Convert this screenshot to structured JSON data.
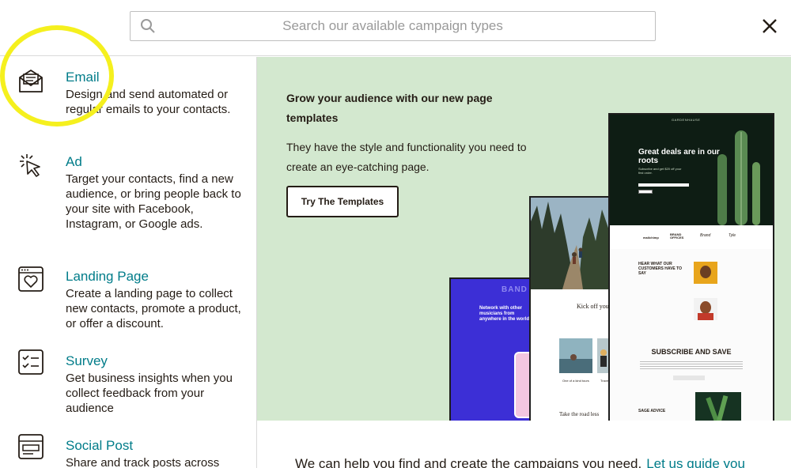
{
  "search": {
    "placeholder": "Search our available campaign types"
  },
  "sidebar": {
    "items": [
      {
        "title": "Email",
        "description": "Design and send automated or regular emails to your contacts.",
        "icon": "email-icon"
      },
      {
        "title": "Ad",
        "description": "Target your contacts, find a new audience, or bring people back to your site with Facebook, Instagram, or Google ads.",
        "icon": "cursor-click-icon"
      },
      {
        "title": "Landing Page",
        "description": "Create a landing page to collect new contacts, promote a product, or offer a discount.",
        "icon": "heart-page-icon"
      },
      {
        "title": "Survey",
        "description": "Get business insights when you collect feedback from your audience",
        "icon": "checklist-icon"
      },
      {
        "title": "Social Post",
        "description": "Share and track posts across",
        "icon": "social-post-icon"
      }
    ]
  },
  "promo": {
    "title": "Grow your audience with our new page templates",
    "description": "They have the style and functionality you need to create an eye-catching page.",
    "button": "Try The Templates",
    "mock_band": {
      "logo": "BAND",
      "headline": "Network with other musicians from anywhere in the world"
    },
    "mock_hike": {
      "heading": "Kick off your",
      "caption1": "One of a kind tours",
      "caption2": "Trave",
      "footer": "Take the road less"
    },
    "mock_garden": {
      "brand": "GARDENHAUSE",
      "headline": "Great deals are in our roots",
      "subtext": "Subscribe and get $20 off your first order.",
      "logos": [
        "mailchimp",
        "BRAND OFFICES",
        "Brand",
        "Tyle"
      ],
      "testimonial_heading": "HEAR WHAT OUR CUSTOMERS HAVE TO SAY",
      "subscribe_heading": "SUBSCRIBE AND SAVE",
      "advice_heading": "SAGE ADVICE"
    }
  },
  "bottom": {
    "text": "We can help you find and create the campaigns you need.",
    "link": "Let us guide you"
  },
  "colors": {
    "accent": "#007c89",
    "promo_bg": "#d3e8cf",
    "highlight": "#f5f01e",
    "band_bg": "#3c2fd6"
  }
}
